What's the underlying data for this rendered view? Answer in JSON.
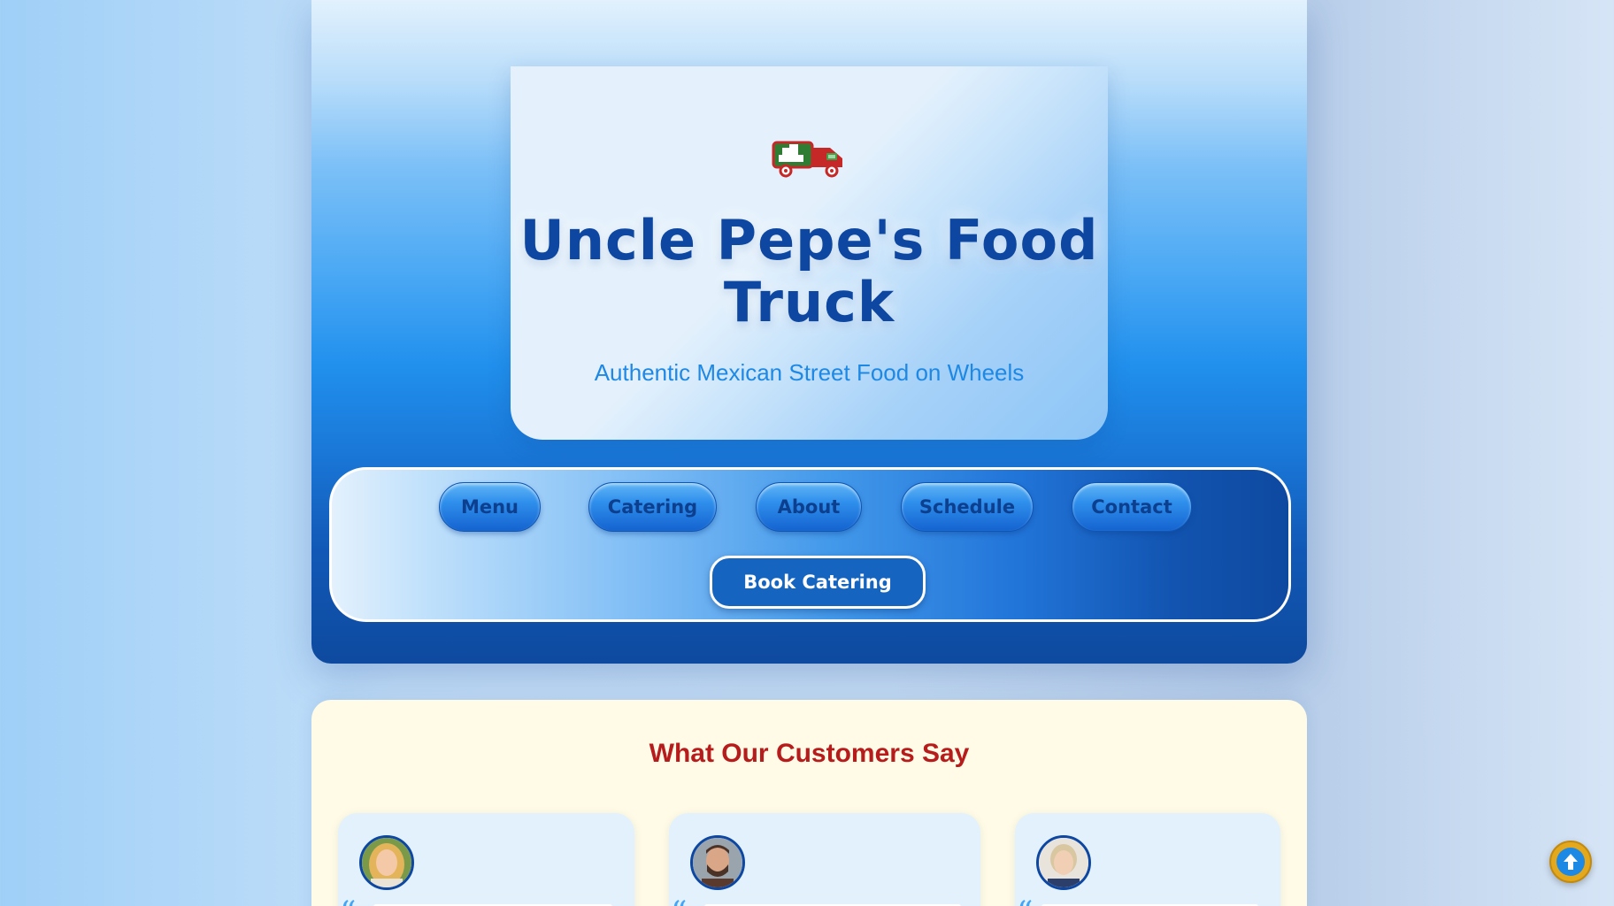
{
  "header": {
    "logo_icon": "food-truck-icon",
    "title": "Uncle Pepe's Food Truck",
    "tagline": "Authentic Mexican Street Food on Wheels"
  },
  "nav": {
    "items": [
      {
        "label": "Menu"
      },
      {
        "label": "Catering"
      },
      {
        "label": "About"
      },
      {
        "label": "Schedule"
      },
      {
        "label": "Contact"
      }
    ],
    "cta_label": "Book Catering"
  },
  "testimonials": {
    "title": "What Our Customers Say",
    "avatars": [
      "avatar-woman-blonde",
      "avatar-man-beard",
      "avatar-woman-short-hair"
    ]
  },
  "scroll_top": {
    "icon": "arrow-up-icon"
  },
  "colors": {
    "brand_blue": "#0d47a1",
    "accent_blue": "#1e88e5",
    "section_heading": "#b71c1c",
    "cream": "#fffbe6",
    "gold": "#e3a81c"
  }
}
